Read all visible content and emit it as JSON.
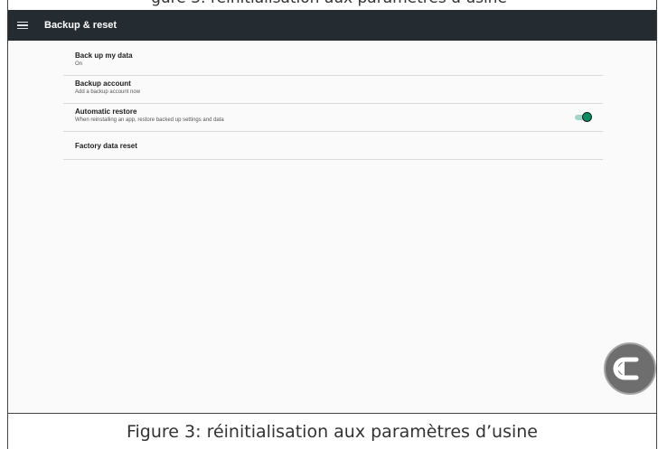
{
  "appbar": {
    "title": "Backup & reset",
    "menu_icon": "hamburger-menu-icon"
  },
  "settings": [
    {
      "title": "Back up my data",
      "summary": "On"
    },
    {
      "title": "Backup account",
      "summary": "Add a backup account now"
    },
    {
      "title": "Automatic restore",
      "summary": "When reinstalling an app, restore backed up settings and data",
      "toggle_on": true
    },
    {
      "title": "Factory data reset"
    }
  ],
  "document": {
    "caption": "Figure 3: réinitialisation aux paramètres d’usine"
  },
  "colors": {
    "appbar": "#252c31",
    "accent": "#0b8a60",
    "track": "#9fd6c8"
  },
  "overlay": {
    "icon": "back-arrow-icon"
  }
}
